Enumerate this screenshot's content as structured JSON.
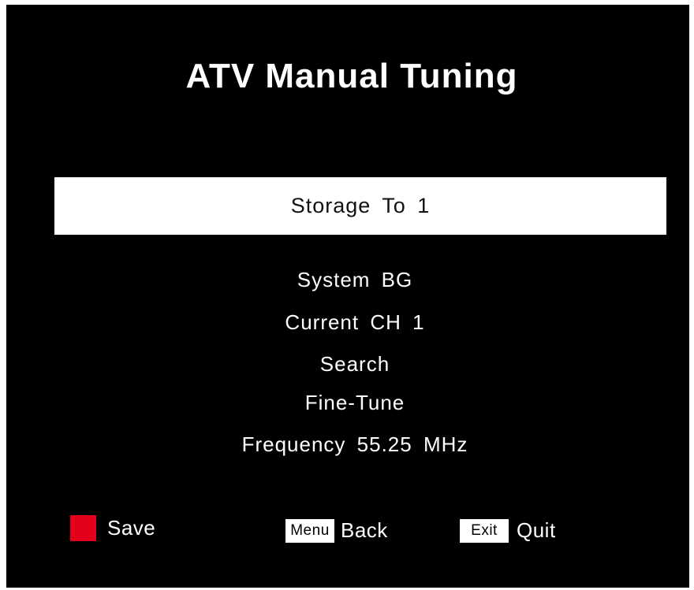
{
  "title": "ATV Manual Tuning",
  "menu": {
    "selected_item": "Storage To 1",
    "items": [
      "System BG",
      "Current CH 1",
      "Search",
      "Fine-Tune",
      "Frequency 55.25 MHz"
    ]
  },
  "footer": {
    "save": {
      "key_color": "#e3001b",
      "label": "Save"
    },
    "back": {
      "key": "Menu",
      "label": "Back"
    },
    "quit": {
      "key": "Exit",
      "label": "Quit"
    }
  }
}
